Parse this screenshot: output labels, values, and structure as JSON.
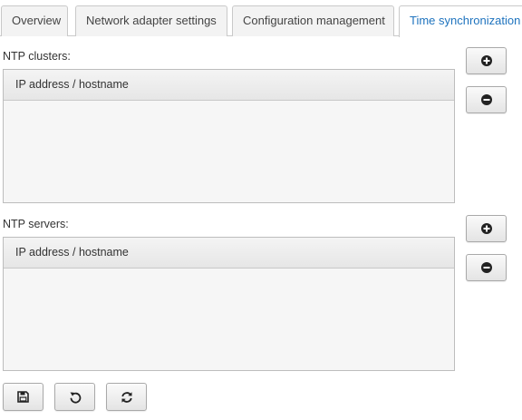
{
  "tabs": [
    {
      "label": "Overview",
      "active": false
    },
    {
      "label": "Network adapter settings",
      "active": false
    },
    {
      "label": "Configuration management",
      "active": false
    },
    {
      "label": "Time synchronization",
      "active": true
    }
  ],
  "ntp_clusters": {
    "label": "NTP clusters:",
    "column_header": "IP address / hostname",
    "rows": []
  },
  "ntp_servers": {
    "label": "NTP servers:",
    "column_header": "IP address / hostname",
    "rows": []
  },
  "icons": {
    "add": "plus-circle-icon",
    "remove": "minus-circle-icon",
    "save": "floppy-disk-icon",
    "undo": "undo-icon",
    "refresh": "refresh-icon"
  },
  "colors": {
    "active_tab_text": "#1e73be",
    "border": "#c9c9c9"
  }
}
